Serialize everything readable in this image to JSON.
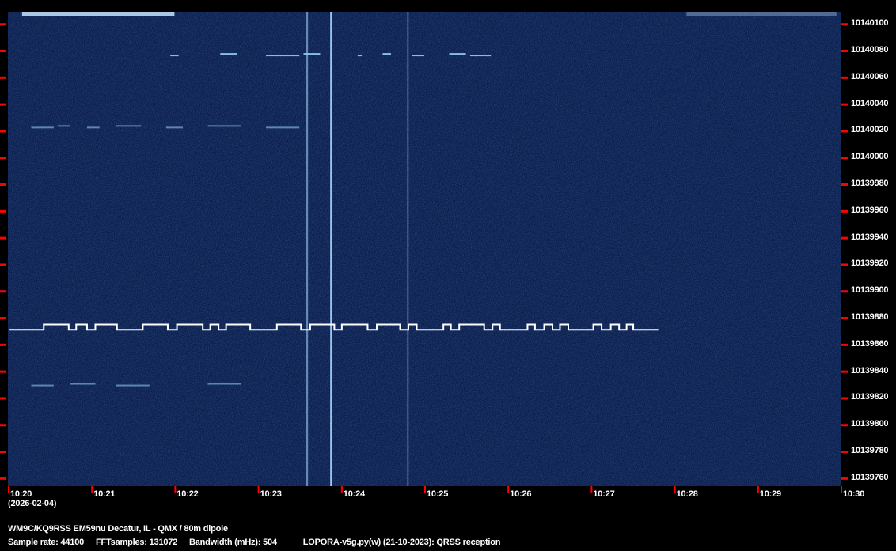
{
  "chart_data": {
    "type": "heatmap",
    "subtype": "spectrogram",
    "date_label": "(2026-02-04)",
    "x_ticks": [
      "10:20",
      "10:21",
      "10:22",
      "10:23",
      "10:24",
      "10:25",
      "10:26",
      "10:27",
      "10:28",
      "10:29",
      "10:30"
    ],
    "x_range_minutes": [
      0,
      10
    ],
    "y_ticks": [
      10140100,
      10140080,
      10140060,
      10140040,
      10140020,
      10140000,
      10139980,
      10139960,
      10139940,
      10139920,
      10139900,
      10139880,
      10139860,
      10139840,
      10139820,
      10139800,
      10139780,
      10139760
    ],
    "y_range_hz": [
      10139754,
      10140109
    ],
    "colors": {
      "background": "#0b1f4e",
      "signal": "#ffffff",
      "weak": "#8fc4f0",
      "tick": "#ff0000"
    },
    "main_signal": {
      "low_hz": 10139871,
      "high_hz": 10139875,
      "start_min": 0.02,
      "end_min": 7.81,
      "high_segments_min": [
        [
          0.43,
          0.73
        ],
        [
          0.82,
          0.95
        ],
        [
          1.05,
          1.31
        ],
        [
          1.62,
          1.92
        ],
        [
          2.03,
          2.34
        ],
        [
          2.43,
          2.53
        ],
        [
          2.62,
          2.91
        ],
        [
          3.23,
          3.52
        ],
        [
          3.63,
          3.92
        ],
        [
          4.01,
          4.32
        ],
        [
          4.43,
          4.71
        ],
        [
          4.81,
          4.91
        ],
        [
          5.23,
          5.32
        ],
        [
          5.42,
          5.72
        ],
        [
          5.82,
          5.91
        ],
        [
          6.24,
          6.33
        ],
        [
          6.44,
          6.54
        ],
        [
          6.63,
          6.73
        ],
        [
          7.03,
          7.13
        ],
        [
          7.24,
          7.34
        ],
        [
          7.43,
          7.51
        ]
      ]
    },
    "weak_signals": [
      {
        "hz": 10140077,
        "segments_min": [
          [
            1.95,
            2.05
          ],
          [
            2.55,
            2.75
          ],
          [
            3.1,
            3.5
          ],
          [
            3.55,
            3.75
          ],
          [
            4.2,
            4.25
          ],
          [
            4.5,
            4.6
          ],
          [
            4.85,
            5.0
          ],
          [
            5.3,
            5.5
          ],
          [
            5.55,
            5.8
          ]
        ]
      },
      {
        "hz": 10140023,
        "segments_min": [
          [
            0.28,
            0.55
          ],
          [
            0.6,
            0.75
          ],
          [
            0.95,
            1.1
          ],
          [
            1.3,
            1.6
          ],
          [
            1.9,
            2.1
          ],
          [
            2.4,
            2.8
          ],
          [
            3.1,
            3.5
          ]
        ]
      },
      {
        "hz": 10139830,
        "segments_min": [
          [
            0.28,
            0.55
          ],
          [
            0.75,
            1.05
          ],
          [
            1.3,
            1.7
          ],
          [
            2.4,
            2.8
          ]
        ]
      }
    ],
    "vertical_lines_min": [
      {
        "t": 3.59,
        "strength": 0.55
      },
      {
        "t": 3.88,
        "strength": 0.9
      },
      {
        "t": 4.8,
        "strength": 0.25
      }
    ],
    "top_band_segments_min": [
      [
        0.17,
        2.0
      ],
      [
        8.15,
        9.95
      ]
    ]
  },
  "footer": {
    "station": "WM9C/KQ9RSS EM59nu Decatur, IL - QMX / 80m dipole",
    "sample_rate": "Sample rate: 44100",
    "fft_samples": "FFTsamples: 131072",
    "bandwidth": "Bandwidth (mHz): 504",
    "program": "LOPORA-v5g.py(w) (21-10-2023): QRSS reception"
  }
}
